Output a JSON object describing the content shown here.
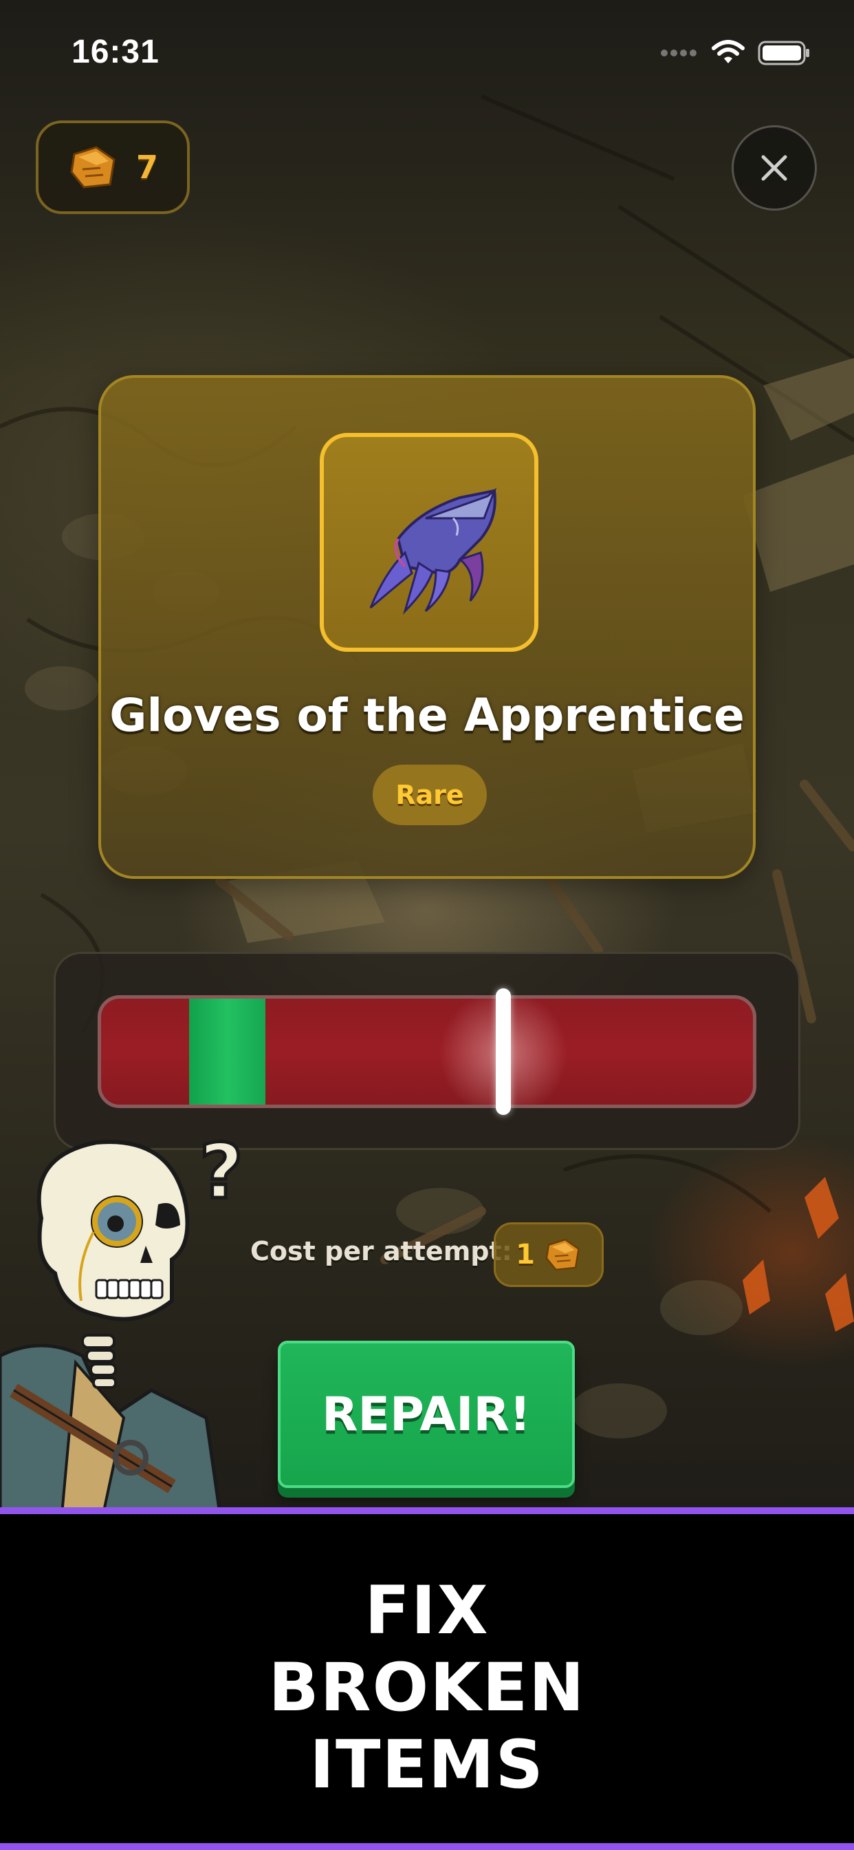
{
  "status_bar": {
    "time": "16:31"
  },
  "hud": {
    "currency_count": "7",
    "currency_icon": "scrap-metal-icon",
    "close_icon": "close-icon"
  },
  "item": {
    "name": "Gloves of the Apprentice",
    "rarity": "Rare",
    "icon": "gauntlet-icon"
  },
  "meter": {
    "target_zone_start": 0.135,
    "target_zone_end": 0.252,
    "needle_position": 0.617
  },
  "repair": {
    "cost_label": "Cost per attempt:",
    "cost_value": "1",
    "button_label": "REPAIR!"
  },
  "caption": {
    "line1": "FIX",
    "line2": "BROKEN",
    "line3": "ITEMS"
  },
  "colors": {
    "gold": "#f5bf2e",
    "meter_red": "#9a1d24",
    "target_green": "#22c161",
    "button_green": "#1aad52",
    "accent_purple": "#9155ee"
  }
}
